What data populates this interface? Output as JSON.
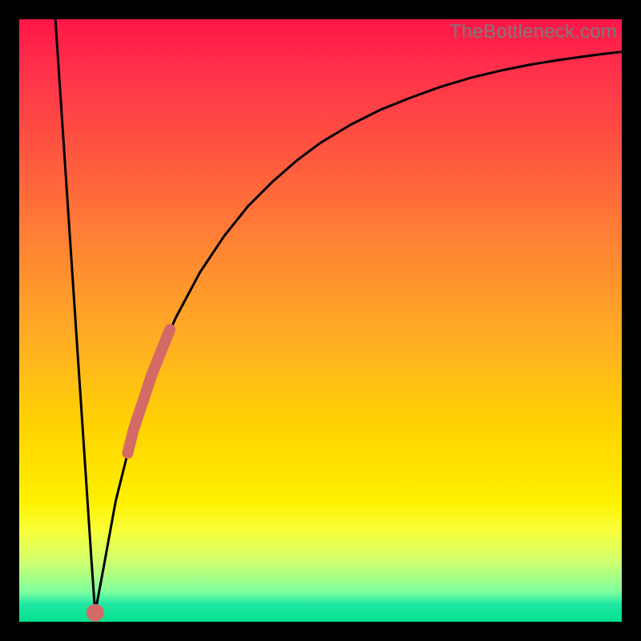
{
  "watermark": {
    "text": "TheBottleneck.com"
  },
  "colors": {
    "curve": "#000000",
    "highlight": "#d46a66",
    "highlight_dot": "#d46a66"
  },
  "chart_data": {
    "type": "line",
    "title": "",
    "xlabel": "",
    "ylabel": "",
    "xlim": [
      0,
      100
    ],
    "ylim": [
      0,
      100
    ],
    "grid": false,
    "legend": false,
    "series": [
      {
        "name": "left-branch",
        "x": [
          6.0,
          7.0,
          8.0,
          9.0,
          10.0,
          11.0,
          12.0,
          12.6
        ],
        "values": [
          100,
          85,
          70,
          55,
          40,
          25,
          10,
          1.5
        ]
      },
      {
        "name": "right-branch",
        "x": [
          12.6,
          14,
          16,
          18,
          20,
          22,
          24,
          26,
          30,
          34,
          38,
          42,
          46,
          50,
          55,
          60,
          65,
          70,
          75,
          80,
          85,
          90,
          95,
          100
        ],
        "values": [
          1.5,
          9,
          20,
          28,
          35,
          41,
          46,
          50.5,
          58,
          64,
          69,
          73,
          76.5,
          79.5,
          82.5,
          85,
          87,
          88.8,
          90.3,
          91.5,
          92.5,
          93.3,
          94,
          94.6
        ]
      },
      {
        "name": "highlight-segment",
        "x": [
          18,
          19,
          20,
          21,
          22,
          23,
          24,
          25
        ],
        "values": [
          28,
          32,
          35,
          38,
          41,
          43.5,
          46,
          48.5
        ]
      }
    ],
    "annotations": [
      {
        "name": "highlight-dot",
        "x": 12.6,
        "y": 1.5
      }
    ]
  }
}
